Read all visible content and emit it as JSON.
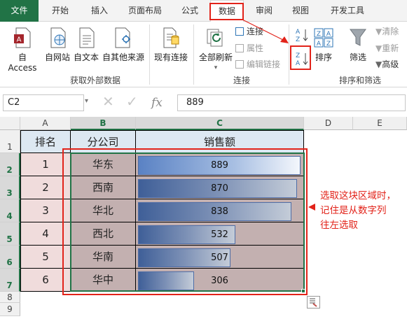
{
  "tabs": [
    {
      "label": "文件"
    },
    {
      "label": "开始"
    },
    {
      "label": "插入"
    },
    {
      "label": "页面布局"
    },
    {
      "label": "公式"
    },
    {
      "label": "数据"
    },
    {
      "label": "审阅"
    },
    {
      "label": "视图"
    },
    {
      "label": "开发工具"
    }
  ],
  "ribbon": {
    "get_external": {
      "buttons": [
        "自 Access",
        "自网站",
        "自文本",
        "自其他来源",
        "现有连接"
      ],
      "group_label": "获取外部数据"
    },
    "connections": {
      "refresh_all": "全部刷新",
      "items": [
        "连接",
        "属性",
        "编辑链接"
      ],
      "group_label": "连接"
    },
    "sort_filter": {
      "sort": "排序",
      "filter": "筛选",
      "items": [
        "清除",
        "重新",
        "高级"
      ],
      "group_label": "排序和筛选"
    }
  },
  "formula_bar": {
    "name_box": "C2",
    "fx": "fx",
    "value": "889"
  },
  "sheet": {
    "columns": [
      "A",
      "B",
      "C",
      "D",
      "E"
    ],
    "rows": [
      "1",
      "2",
      "3",
      "4",
      "5",
      "6",
      "7",
      "8",
      "9"
    ],
    "headers": [
      "排名",
      "分公司",
      "销售额"
    ],
    "data": [
      {
        "rank": "1",
        "branch": "华东",
        "sales": "889",
        "fill": 1.0
      },
      {
        "rank": "2",
        "branch": "西南",
        "sales": "870",
        "fill": 0.979
      },
      {
        "rank": "3",
        "branch": "华北",
        "sales": "838",
        "fill": 0.943
      },
      {
        "rank": "4",
        "branch": "西北",
        "sales": "532",
        "fill": 0.598
      },
      {
        "rank": "5",
        "branch": "华南",
        "sales": "507",
        "fill": 0.57
      },
      {
        "rank": "6",
        "branch": "华中",
        "sales": "306",
        "fill": 0.344
      }
    ]
  },
  "annotation": [
    "选取这块区域时，",
    "记住是从数字列",
    "往左选取"
  ],
  "colors": {
    "accent": "#217346",
    "highlight": "#e2231a"
  }
}
